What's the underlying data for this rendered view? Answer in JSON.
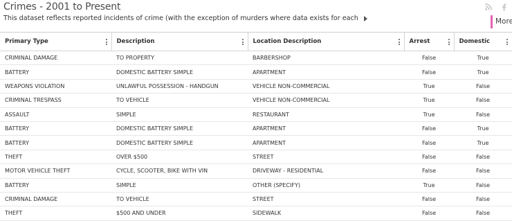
{
  "dataset": {
    "title": "Crimes - 2001 to Present",
    "description": "This dataset reflects reported incidents of crime (with the exception of murders where data exists for each",
    "more_label": "More"
  },
  "share": {
    "icons": [
      "rss-icon",
      "facebook-icon"
    ]
  },
  "colors": {
    "accent": "#e363b5",
    "border": "#d4d4d4"
  },
  "table": {
    "columns": [
      "Primary Type",
      "Description",
      "Location Description",
      "Arrest",
      "Domestic"
    ],
    "rows": [
      [
        "CRIMINAL DAMAGE",
        "TO PROPERTY",
        "BARBERSHOP",
        "False",
        "True"
      ],
      [
        "BATTERY",
        "DOMESTIC BATTERY SIMPLE",
        "APARTMENT",
        "False",
        "True"
      ],
      [
        "WEAPONS VIOLATION",
        "UNLAWFUL POSSESSION - HANDGUN",
        "VEHICLE NON-COMMERCIAL",
        "True",
        "False"
      ],
      [
        "CRIMINAL TRESPASS",
        "TO VEHICLE",
        "VEHICLE NON-COMMERCIAL",
        "True",
        "False"
      ],
      [
        "ASSAULT",
        "SIMPLE",
        "RESTAURANT",
        "True",
        "False"
      ],
      [
        "BATTERY",
        "DOMESTIC BATTERY SIMPLE",
        "APARTMENT",
        "False",
        "True"
      ],
      [
        "BATTERY",
        "DOMESTIC BATTERY SIMPLE",
        "APARTMENT",
        "False",
        "True"
      ],
      [
        "THEFT",
        "OVER $500",
        "STREET",
        "False",
        "False"
      ],
      [
        "MOTOR VEHICLE THEFT",
        "CYCLE, SCOOTER, BIKE WITH VIN",
        "DRIVEWAY - RESIDENTIAL",
        "False",
        "False"
      ],
      [
        "BATTERY",
        "SIMPLE",
        "OTHER (SPECIFY)",
        "True",
        "False"
      ],
      [
        "CRIMINAL DAMAGE",
        "TO VEHICLE",
        "STREET",
        "False",
        "False"
      ],
      [
        "THEFT",
        "$500 AND UNDER",
        "SIDEWALK",
        "False",
        "False"
      ]
    ]
  }
}
